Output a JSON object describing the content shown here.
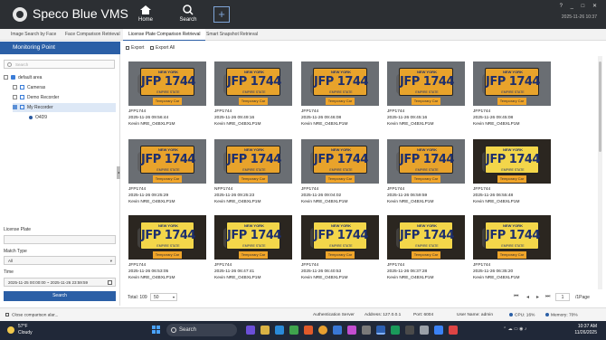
{
  "app": {
    "name": "Speco Blue VMS",
    "nav": [
      {
        "label": "Home"
      },
      {
        "label": "Search"
      }
    ],
    "add_symbol": "+",
    "window_controls": [
      "?",
      "_",
      "□",
      "✕"
    ],
    "datetime": "2025-11-26 10:37"
  },
  "tabs": [
    {
      "label": "Image Search by Face",
      "active": false
    },
    {
      "label": "Face Comparison Retrieval",
      "active": false
    },
    {
      "label": "License Plate Comparison Retrieval",
      "active": true
    },
    {
      "label": "Smart Snapshot Retrieval",
      "active": false
    }
  ],
  "left_panel": {
    "title": "Monitoring Point",
    "search_placeholder": "Search",
    "tree": [
      {
        "label": "default area",
        "icon": "network-icon"
      },
      {
        "label": "Cameras",
        "icon": "house-icon"
      },
      {
        "label": "Demo Recorder",
        "icon": "house-icon"
      },
      {
        "label": "My Recorder",
        "icon": "house-icon",
        "selected": true
      },
      {
        "label": "O4D9",
        "icon": "camera-icon"
      }
    ],
    "license_plate_label": "License Plate",
    "license_plate_value": "",
    "match_type_label": "Match Type",
    "match_type_value": "All",
    "time_label": "Time",
    "time_value": "2025-11-25 00:00:00  ~  2025-11-26 23:59:59",
    "search_button": "Search"
  },
  "toolbar": {
    "export": "Export",
    "export_all": "Export All"
  },
  "results": [
    {
      "plate_text": "JFP 1744",
      "state": "NEW YORK",
      "footer": "EMPIRE STATE",
      "tag": "Temporary Car",
      "plate": "JFP1744",
      "time": "2025-11-26 09:56:44",
      "camera": "Kevin NRE_O4BXLP1M",
      "lit": false
    },
    {
      "plate_text": "JFP 1744",
      "state": "NEW YORK",
      "footer": "EMPIRE STATE",
      "tag": "Temporary Car",
      "plate": "JFP1744",
      "time": "2025-11-26 09:49:16",
      "camera": "Kevin NRE_O4BXLP1M",
      "lit": false
    },
    {
      "plate_text": "JFP 1744",
      "state": "NEW YORK",
      "footer": "EMPIRE STATE",
      "tag": "Temporary Car",
      "plate": "JFP1744",
      "time": "2025-11-26 09:46:08",
      "camera": "Kevin NRE_O4BXLP1M",
      "lit": false
    },
    {
      "plate_text": "JFP 1744",
      "state": "NEW YORK",
      "footer": "EMPIRE STATE",
      "tag": "Temporary Car",
      "plate": "JFP1744",
      "time": "2025-11-26 09:45:16",
      "camera": "Kevin NRE_O4BXLP1M",
      "lit": false
    },
    {
      "plate_text": "JFP 1744",
      "state": "NEW YORK",
      "footer": "EMPIRE STATE",
      "tag": "Temporary Car",
      "plate": "JFP1744",
      "time": "2025-11-26 09:45:08",
      "camera": "Kevin NRE_O4BXLP1M",
      "lit": false
    },
    {
      "plate_text": "JFP 1744",
      "state": "NEW YORK",
      "footer": "EMPIRE STATE",
      "tag": "Temporary Car",
      "plate": "JFP1744",
      "time": "2025-11-26 09:25:29",
      "camera": "Kevin NRE_O4BXLP1M",
      "lit": false
    },
    {
      "plate_text": "JFP 1744",
      "state": "NEW YORK",
      "footer": "EMPIRE STATE",
      "tag": "Temporary Car",
      "plate": "NFP1744",
      "time": "2025-11-26 09:25:23",
      "camera": "Kevin NRE_O4BXLP1M",
      "lit": false
    },
    {
      "plate_text": "JFP 1744",
      "state": "NEW YORK",
      "footer": "EMPIRE STATE",
      "tag": "Temporary Car",
      "plate": "JFP1744",
      "time": "2025-11-26 09:04:02",
      "camera": "Kevin NRE_O4BXLP1M",
      "lit": false
    },
    {
      "plate_text": "JFP 1744",
      "state": "NEW YORK",
      "footer": "EMPIRE STATE",
      "tag": "Temporary Car",
      "plate": "JFP1744",
      "time": "2025-11-26 06:59:59",
      "camera": "Kevin NRE_O4BXLP1M",
      "lit": false
    },
    {
      "plate_text": "JFP 1744",
      "state": "NEW YORK",
      "footer": "EMPIRE STATE",
      "tag": "Temporary Car",
      "plate": "JFP1744",
      "time": "2025-11-26 06:55:48",
      "camera": "Kevin NRE_O4BXLP1M",
      "lit": true
    },
    {
      "plate_text": "JFP 1744",
      "state": "NEW YORK",
      "footer": "EMPIRE STATE",
      "tag": "Temporary Car",
      "plate": "JFP1744",
      "time": "2025-11-26 06:53:05",
      "camera": "Kevin NRE_O4BXLP1M",
      "lit": true
    },
    {
      "plate_text": "JFP 1744",
      "state": "NEW YORK",
      "footer": "EMPIRE STATE",
      "tag": "Temporary Car",
      "plate": "JFP1744",
      "time": "2025-11-26 06:47:41",
      "camera": "Kevin NRE_O4BXLP1M",
      "lit": true
    },
    {
      "plate_text": "JFP 1744",
      "state": "NEW YORK",
      "footer": "EMPIRE STATE",
      "tag": "Temporary Car",
      "plate": "JFP1744",
      "time": "2025-11-26 06:40:53",
      "camera": "Kevin NRE_O4BXLP1M",
      "lit": true
    },
    {
      "plate_text": "JFP 1744",
      "state": "NEW YORK",
      "footer": "EMPIRE STATE",
      "tag": "Temporary Car",
      "plate": "JFP1744",
      "time": "2025-11-26 06:37:28",
      "camera": "Kevin NRE_O4BXLP1M",
      "lit": true
    },
    {
      "plate_text": "JFP 1744",
      "state": "NEW YORK",
      "footer": "EMPIRE STATE",
      "tag": "Temporary Car",
      "plate": "JFP1744",
      "time": "2025-11-26 06:35:20",
      "camera": "Kevin NRE_O4BXLP1M",
      "lit": true
    }
  ],
  "pager": {
    "total": "Total: 109",
    "page_size": "50",
    "page": "1",
    "per_page_label": "/1Page"
  },
  "status": {
    "message": "Close comparison alar...",
    "auth_server": "Authentication Server",
    "address": "Address: 127.0.0.1",
    "port": "Port: 6004",
    "user": "User Name: admin",
    "cpu": "CPU: 16%",
    "memory": "Memory: 70%"
  },
  "taskbar": {
    "temp": "57°F",
    "condition": "Cloudy",
    "search": "Search",
    "time": "10:37 AM",
    "date": "11/26/2025"
  },
  "colors": {
    "brand_blue": "#2b5fa6",
    "titlebar": "#2c2f33",
    "plate_orange": "#e8a32b",
    "plate_yellow": "#f3d64a"
  }
}
